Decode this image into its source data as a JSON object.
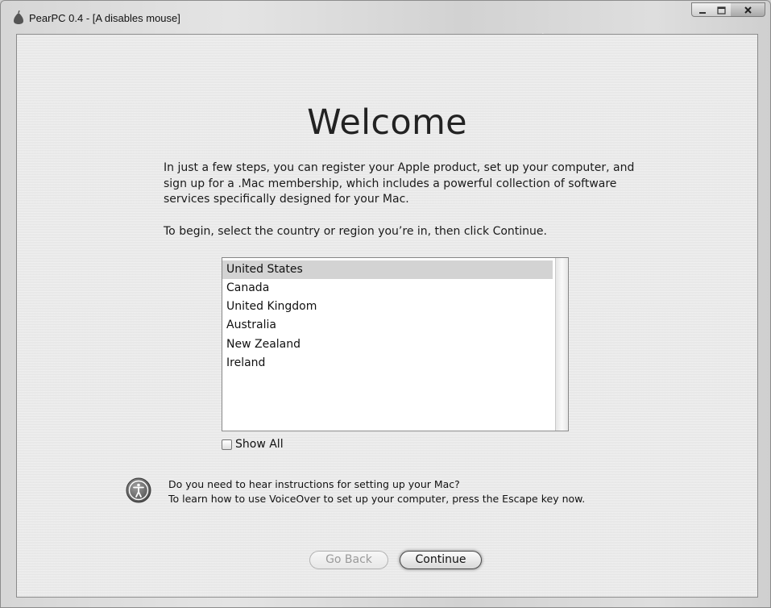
{
  "window": {
    "title": "PearPC 0.4 - [A disables mouse]",
    "controls": [
      "minimize-icon",
      "maximize-icon",
      "close-icon"
    ]
  },
  "welcome": {
    "heading": "Welcome",
    "intro": "In just a few steps, you can register your Apple product, set up your computer, and sign up for a .Mac membership, which includes a powerful collection of software services specifically designed for your Mac.",
    "instruction": "To begin, select the country or region you’re in, then click Continue."
  },
  "country_list": {
    "items": [
      "United States",
      "Canada",
      "United Kingdom",
      "Australia",
      "New Zealand",
      "Ireland"
    ],
    "selected": "United States"
  },
  "show_all": {
    "label": "Show All",
    "checked": false
  },
  "voiceover": {
    "icon": "accessibility-icon",
    "line1": "Do you need to hear instructions for setting up your Mac?",
    "line2": "To learn how to use VoiceOver to set up your computer, press the Escape key now."
  },
  "buttons": {
    "back": "Go Back",
    "back_enabled": false,
    "continue": "Continue"
  }
}
